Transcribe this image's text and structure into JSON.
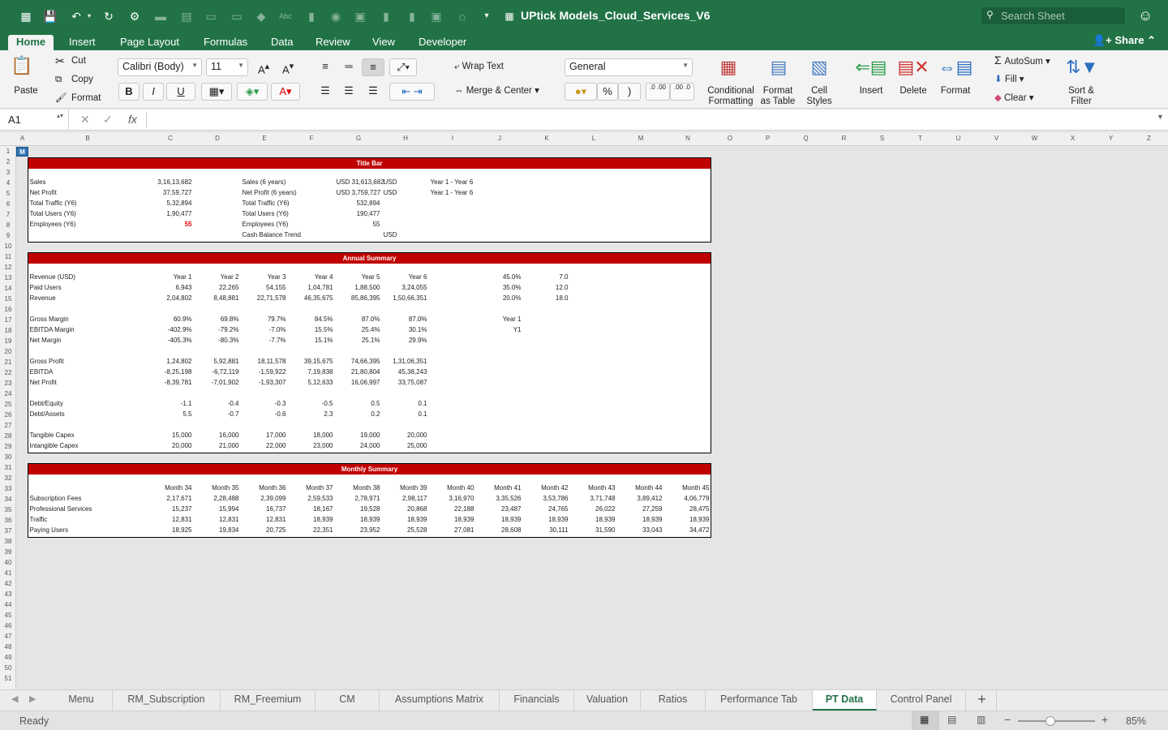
{
  "app": {
    "title": "UPtick Models_Cloud_Services_V6",
    "search_placeholder": "Search Sheet",
    "share_label": "Share"
  },
  "ribbon_tabs": [
    "Home",
    "Insert",
    "Page Layout",
    "Formulas",
    "Data",
    "Review",
    "View",
    "Developer"
  ],
  "ribbon": {
    "paste": "Paste",
    "cut": "Cut",
    "copy": "Copy",
    "format_painter": "Format",
    "font_name": "Calibri (Body)",
    "font_size": "11",
    "bold": "B",
    "italic": "I",
    "underline": "U",
    "wrap_text": "Wrap Text",
    "merge_center": "Merge & Center",
    "number_format": "General",
    "percent": "%",
    "comma": ")",
    "conditional_formatting": "Conditional Formatting",
    "format_as_table": "Format as Table",
    "cell_styles": "Cell Styles",
    "insert": "Insert",
    "delete": "Delete",
    "format": "Format",
    "autosum": "AutoSum",
    "fill": "Fill",
    "clear": "Clear",
    "sort_filter": "Sort & Filter",
    "font_grow": "A",
    "font_shrink": "A",
    "inc_dec": ".0 .00",
    "dec_dec": ".00 .0"
  },
  "formula_bar": {
    "name_box": "A1",
    "fx": "fx",
    "formula": ""
  },
  "columns": [
    "A",
    "B",
    "C",
    "D",
    "E",
    "F",
    "G",
    "H",
    "I",
    "J",
    "K",
    "L",
    "M",
    "N",
    "O",
    "P",
    "Q",
    "R",
    "S",
    "T",
    "U",
    "V",
    "W",
    "X",
    "Y",
    "Z"
  ],
  "rows": [
    "1",
    "2",
    "3",
    "4",
    "5",
    "6",
    "7",
    "8",
    "9",
    "10",
    "11",
    "12",
    "13",
    "14",
    "15",
    "16",
    "17",
    "18",
    "19",
    "20",
    "21",
    "22",
    "23",
    "24",
    "25",
    "26",
    "27",
    "28",
    "29",
    "30",
    "31",
    "32",
    "33",
    "34",
    "35",
    "36",
    "37",
    "38",
    "39",
    "40",
    "41",
    "42",
    "43",
    "44",
    "45",
    "46",
    "47",
    "48",
    "49",
    "50",
    "51"
  ],
  "selected_cell_text": "M",
  "title_bar": {
    "header": "Title Bar",
    "left": [
      {
        "label": "Sales",
        "value": "3,16,13,682"
      },
      {
        "label": "Net Profit",
        "value": "37,59,727"
      },
      {
        "label": "Total Traffic (Y6)",
        "value": "5,32,894"
      },
      {
        "label": "Total Users (Y6)",
        "value": "1,90,477"
      },
      {
        "label": "Employees (Y6)",
        "value": "55"
      }
    ],
    "right": [
      {
        "label": "Sales (6 years)",
        "value": "USD 31,613,682",
        "unit": "USD",
        "note": "Year 1 - Year 6"
      },
      {
        "label": "Net Profit (6 years)",
        "value": "USD 3,759,727",
        "unit": "USD",
        "note": "Year 1 - Year 6"
      },
      {
        "label": "Total Traffic (Y6)",
        "value": "532,894",
        "unit": "",
        "note": ""
      },
      {
        "label": "Total Users (Y6)",
        "value": "190,477",
        "unit": "",
        "note": ""
      },
      {
        "label": "Employees (Y6)",
        "value": "55",
        "unit": "",
        "note": ""
      },
      {
        "label": "Cash Balance Trend",
        "value": "",
        "unit": "USD",
        "note": ""
      }
    ]
  },
  "annual": {
    "header": "Annual Summary",
    "columns": [
      "Year 1",
      "Year 2",
      "Year 3",
      "Year 4",
      "Year 5",
      "Year 6"
    ],
    "rows": [
      {
        "label": "Revenue (USD)",
        "values": [
          "Year 1",
          "Year 2",
          "Year 3",
          "Year 4",
          "Year 5",
          "Year 6"
        ]
      },
      {
        "label": "Paid Users",
        "values": [
          "6,943",
          "22,265",
          "54,155",
          "1,04,781",
          "1,88,500",
          "3,24,055"
        ]
      },
      {
        "label": "Revenue",
        "values": [
          "2,04,802",
          "8,48,881",
          "22,71,578",
          "46,35,675",
          "85,86,395",
          "1,50,66,351"
        ]
      },
      {
        "label": "Gross Margin",
        "values": [
          "60.9%",
          "69.8%",
          "79.7%",
          "84.5%",
          "87.0%",
          "87.0%"
        ]
      },
      {
        "label": "EBITDA Margin",
        "values": [
          "-402.9%",
          "-79.2%",
          "-7.0%",
          "15.5%",
          "25.4%",
          "30.1%"
        ]
      },
      {
        "label": "Net Margin",
        "values": [
          "-405.3%",
          "-80.3%",
          "-7.7%",
          "15.1%",
          "25.1%",
          "29.9%"
        ]
      },
      {
        "label": "Gross Profit",
        "values": [
          "1,24,802",
          "5,92,881",
          "18,11,578",
          "39,15,675",
          "74,66,395",
          "1,31,06,351"
        ]
      },
      {
        "label": "EBITDA",
        "values": [
          "-8,25,198",
          "-6,72,119",
          "-1,59,922",
          "7,19,838",
          "21,80,804",
          "45,38,243"
        ]
      },
      {
        "label": "Net Profit",
        "values": [
          "-8,39,781",
          "-7,01,902",
          "-1,93,307",
          "5,12,633",
          "16,06,997",
          "33,75,087"
        ]
      },
      {
        "label": "Debt/Equity",
        "values": [
          "-1.1",
          "-0.4",
          "-0.3",
          "-0.5",
          "0.5",
          "0.1"
        ]
      },
      {
        "label": "Debt/Assets",
        "values": [
          "5.5",
          "-0.7",
          "-0.6",
          "2.3",
          "0.2",
          "0.1"
        ]
      },
      {
        "label": "Tangible Capex",
        "values": [
          "15,000",
          "16,000",
          "17,000",
          "18,000",
          "19,000",
          "20,000"
        ]
      },
      {
        "label": "Intangible Capex",
        "values": [
          "20,000",
          "21,000",
          "22,000",
          "23,000",
          "24,000",
          "25,000"
        ]
      }
    ],
    "side": {
      "j": [
        "45.0%",
        "35.0%",
        "20.0%"
      ],
      "k": [
        "7.0",
        "12.0",
        "18.0"
      ],
      "j17": "Year 1",
      "j18": "Y1"
    }
  },
  "monthly": {
    "header": "Monthly Summary",
    "columns": [
      "Month 34",
      "Month 35",
      "Month 36",
      "Month 37",
      "Month 38",
      "Month 39",
      "Month 40",
      "Month 41",
      "Month 42",
      "Month 43",
      "Month 44",
      "Month 45"
    ],
    "rows": [
      {
        "label": "Subscription Fees",
        "values": [
          "2,17,671",
          "2,28,488",
          "2,39,099",
          "2,59,533",
          "2,78,971",
          "2,98,117",
          "3,16,970",
          "3,35,526",
          "3,53,786",
          "3,71,748",
          "3,89,412",
          "4,06,779"
        ]
      },
      {
        "label": "Professional Services",
        "values": [
          "15,237",
          "15,994",
          "16,737",
          "18,167",
          "19,528",
          "20,868",
          "22,188",
          "23,487",
          "24,765",
          "26,022",
          "27,259",
          "28,475"
        ]
      },
      {
        "label": "Traffic",
        "values": [
          "12,831",
          "12,831",
          "12,831",
          "18,939",
          "18,939",
          "18,939",
          "18,939",
          "18,939",
          "18,939",
          "18,939",
          "18,939",
          "18,939"
        ]
      },
      {
        "label": "Paying Users",
        "values": [
          "18,925",
          "19,834",
          "20,725",
          "22,351",
          "23,952",
          "25,528",
          "27,081",
          "28,608",
          "30,111",
          "31,590",
          "33,043",
          "34,472"
        ]
      }
    ]
  },
  "sheet_tabs": [
    "Menu",
    "RM_Subscription",
    "RM_Freemium",
    "CM",
    "Assumptions Matrix",
    "Financials",
    "Valuation",
    "Ratios",
    "Performance Tab",
    "PT Data",
    "Control Panel"
  ],
  "active_sheet": "PT Data",
  "status": {
    "ready": "Ready",
    "zoom": "85%"
  },
  "colors": {
    "excel_green": "#217346",
    "header_red": "#c00000",
    "selection_blue": "#2f75b5"
  }
}
